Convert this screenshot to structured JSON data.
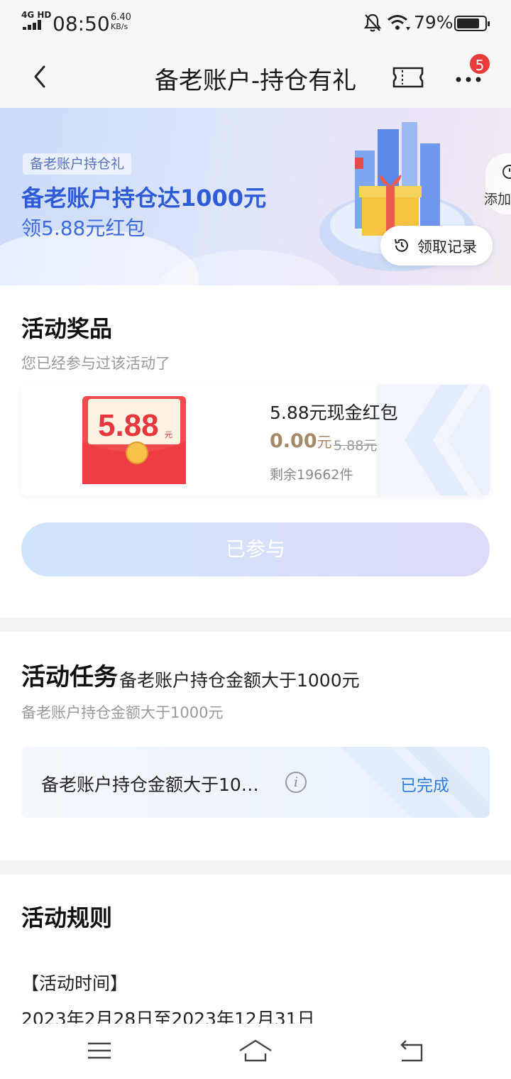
{
  "status_bar": {
    "network": "4G HD",
    "time": "08:50",
    "speed_value": "6.40",
    "speed_unit": "KB/s",
    "battery": "79%"
  },
  "header": {
    "title": "备老账户-持仓有礼",
    "badge_count": "5"
  },
  "banner": {
    "tag": "备老账户持仓礼",
    "headline": "备老账户持仓达1000元",
    "subline": "领5.88元红包",
    "record_label": "领取记录",
    "add_label": "添加"
  },
  "prize": {
    "section_title": "活动奖品",
    "section_sub": "您已经参与过该活动了",
    "redpack_amount": "5.88",
    "redpack_unit": "元",
    "name": "5.88元现金红包",
    "price": "0.00",
    "price_unit": "元",
    "original_price": "5.88元",
    "remaining": "剩余19662件",
    "button_label": "已参与"
  },
  "task": {
    "section_title": "活动任务",
    "section_title_extra": "备老账户持仓金额大于1000元",
    "section_sub": "备老账户持仓金额大于1000元",
    "item_text": "备老账户持仓金额大于10…",
    "info_icon": "i",
    "status": "已完成"
  },
  "rules": {
    "section_title": "活动规则",
    "heading": "【活动时间】",
    "date_range": "2023年2月28日至2023年12月31日"
  },
  "colors": {
    "accent_blue": "#2e5bd8",
    "status_blue": "#2f7de1",
    "price_gold": "#a58a6a",
    "badge_red": "#ea3b3b"
  }
}
